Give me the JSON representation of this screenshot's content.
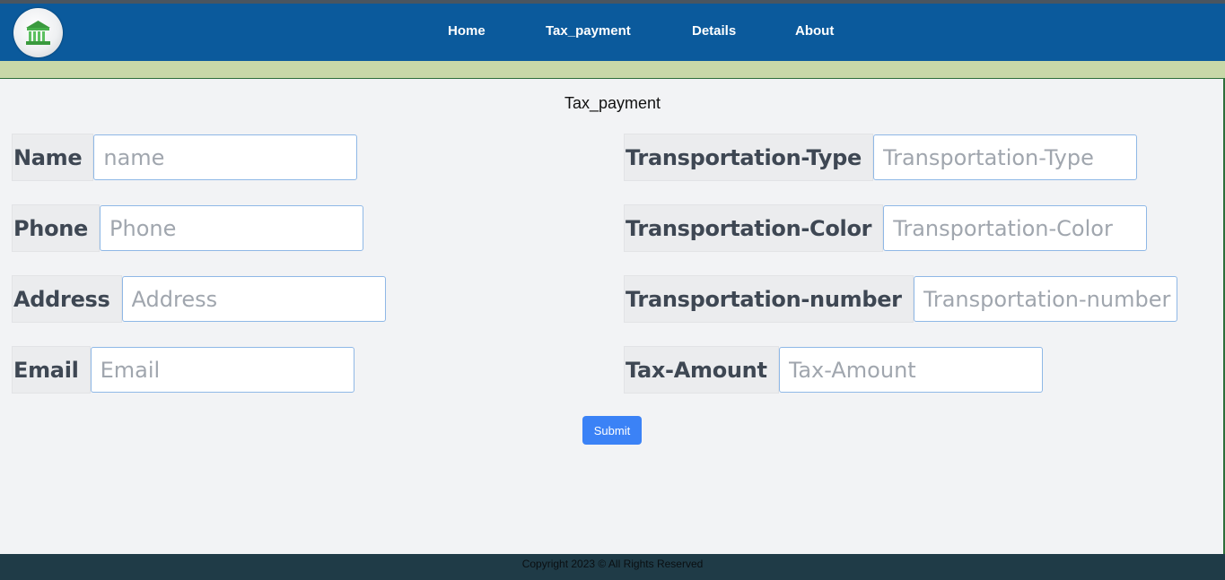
{
  "nav": {
    "links": [
      "Home",
      "Tax_payment",
      "Details",
      "About"
    ]
  },
  "page": {
    "title": "Tax_payment"
  },
  "form": {
    "left": [
      {
        "label": "Name",
        "placeholder": "name"
      },
      {
        "label": "Phone",
        "placeholder": "Phone"
      },
      {
        "label": "Address",
        "placeholder": "Address"
      },
      {
        "label": "Email",
        "placeholder": "Email"
      }
    ],
    "right": [
      {
        "label": "Transportation-Type",
        "placeholder": "Transportation-Type"
      },
      {
        "label": "Transportation-Color",
        "placeholder": "Transportation-Color"
      },
      {
        "label": "Transportation-number",
        "placeholder": "Transportation-number"
      },
      {
        "label": "Tax-Amount",
        "placeholder": "Tax-Amount"
      }
    ],
    "submit_label": "Submit"
  },
  "footer": {
    "text": "Copyright 2023 © All Rights Reserved"
  },
  "colors": {
    "navbar": "#0b5a9c",
    "accent_bar": "#c8d8a8",
    "submit": "#3b82f6",
    "footer": "#1f3b47"
  }
}
